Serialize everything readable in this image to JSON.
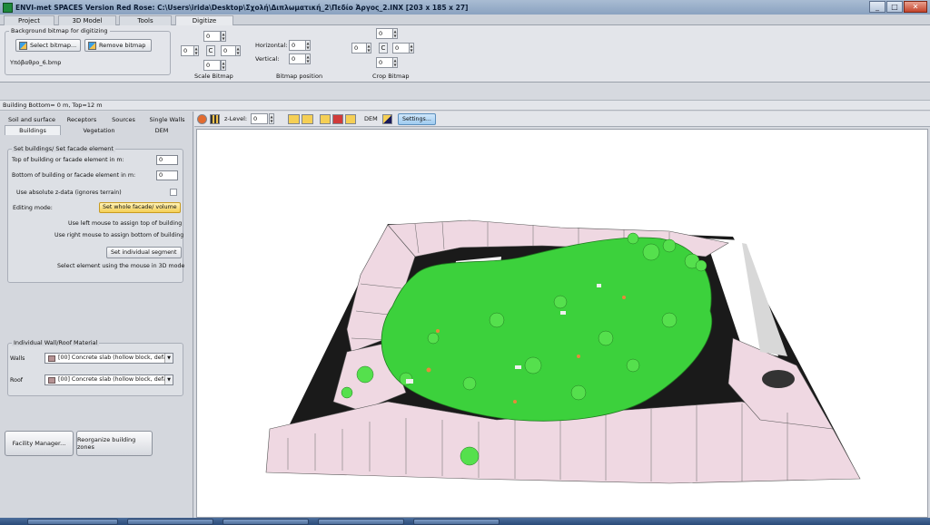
{
  "window": {
    "title": "ENVI-met SPACES Version Red Rose:  C:\\Users\\irida\\Desktop\\Σχολή\\Διπλωματική_2\\Πεδίο Άργος_2.INX [203 x 185 x 27]",
    "controls": [
      "_",
      "□",
      "✕"
    ]
  },
  "menu_tabs": [
    "Project",
    "3D Model",
    "Tools",
    "Digitize"
  ],
  "ribbon": {
    "bg_group_title": "Background bitmap for digitizing",
    "select_bitmap": "Select bitmap...",
    "remove_bitmap": "Remove bitmap",
    "bitmap_file": "Υπόβαθρο_6.bmp",
    "scale_bitmap": {
      "title": "Scale Bitmap",
      "top": "0",
      "left": "0",
      "center": "C",
      "right": "0",
      "bottom": "0"
    },
    "bitmap_position": {
      "title": "Bitmap position",
      "horizontal_label": "Horizontal:",
      "horizontal": "0",
      "vertical_label": "Vertical:",
      "vertical": "0"
    },
    "crop_bitmap": {
      "title": "Crop Bitmap",
      "top": "0",
      "left": "0",
      "center": "C",
      "right": "0",
      "bottom": "0"
    }
  },
  "status_line": "Building Bottom= 0 m, Top=12 m",
  "left_tabs_row1": [
    "Soil and surface",
    "Receptors",
    "Sources",
    "Single Walls"
  ],
  "left_tabs_row2": [
    "Buildings",
    "Vegetation",
    "DEM"
  ],
  "buildings_panel": {
    "title": "Set buildings/ Set facade element",
    "top_label": "Top of building or facade element in m:",
    "top_value": "0",
    "bottom_label": "Bottom of building or facade element in m:",
    "bottom_value": "0",
    "absolute_z": "Use absolute z-data (ignores terrain)",
    "editing_mode_label": "Editing mode:",
    "editing_mode_button": "Set whole facade/ volume",
    "left_mouse_hint": "Use left mouse to assign top of building",
    "right_mouse_hint": "Use right mouse to assign bottom of building",
    "individual_segment": "Set individual segment",
    "select_hint": "Select element using the mouse in 3D mode"
  },
  "material_panel": {
    "title": "Individual Wall/Roof Material",
    "walls_label": "Walls",
    "walls_value": "[00] Concrete slab (hollow block, defa",
    "roof_label": "Roof",
    "roof_value": "[00] Concrete slab (hollow block, defa"
  },
  "bottom_buttons": {
    "facility_manager": "Facility Manager...",
    "reorganize": "Reorganize building zones"
  },
  "toolbar_3d": {
    "z_level_label": "z-Level:",
    "z_level_value": "0",
    "dem_label": "DEM",
    "settings": "Settings..."
  },
  "colors": {
    "vegetation": "#3cd13c",
    "buildings": "#efd8e2",
    "ground_shadow": "#1a1a1a",
    "accent_yellow": "#f5cf55",
    "title_bar": "#8aa2c0"
  }
}
